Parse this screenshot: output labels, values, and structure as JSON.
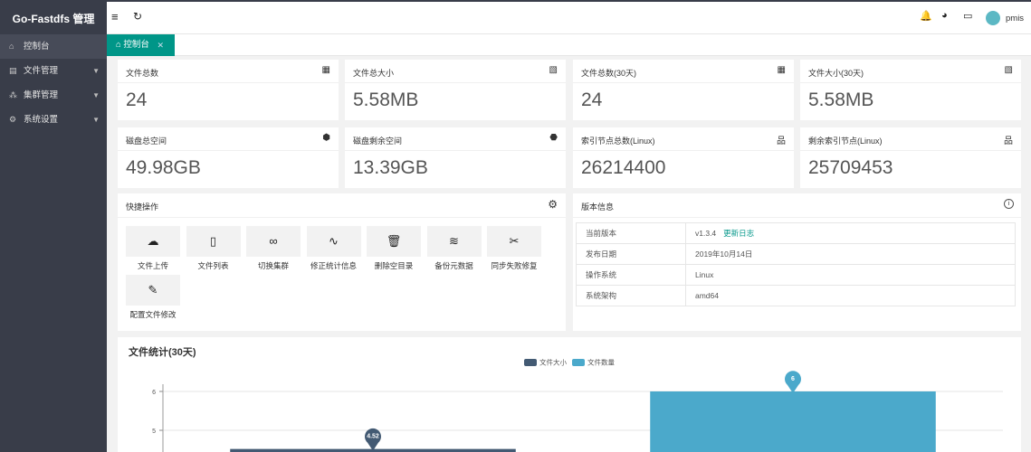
{
  "app": {
    "title": "Go-Fastdfs 管理"
  },
  "sidebar": {
    "items": [
      {
        "label": "控制台",
        "icon": "home-icon",
        "glyph": "⌂",
        "has_caret": false
      },
      {
        "label": "文件管理",
        "icon": "file-icon",
        "glyph": "▤",
        "has_caret": true
      },
      {
        "label": "集群管理",
        "icon": "cluster-icon",
        "glyph": "⁂",
        "has_caret": true
      },
      {
        "label": "系统设置",
        "icon": "gears-icon",
        "glyph": "⚙",
        "has_caret": true
      }
    ]
  },
  "header": {
    "user": "pmis"
  },
  "tabs": {
    "active": "控制台"
  },
  "stats": [
    {
      "title": "文件总数",
      "value": "24",
      "icon": "calculator-icon",
      "glyph": "▦"
    },
    {
      "title": "文件总大小",
      "value": "5.58MB",
      "icon": "file-size-icon",
      "glyph": "▧"
    },
    {
      "title": "文件总数(30天)",
      "value": "24",
      "icon": "calculator-icon",
      "glyph": "▦"
    },
    {
      "title": "文件大小(30天)",
      "value": "5.58MB",
      "icon": "file-size-icon",
      "glyph": "▧"
    },
    {
      "title": "磁盘总空间",
      "value": "49.98GB",
      "icon": "cubes-icon",
      "glyph": "⬢"
    },
    {
      "title": "磁盘剩余空间",
      "value": "13.39GB",
      "icon": "cube-icon",
      "glyph": "⬣"
    },
    {
      "title": "索引节点总数(Linux)",
      "value": "26214400",
      "icon": "sitemap-icon",
      "glyph": "品"
    },
    {
      "title": "剩余索引节点(Linux)",
      "value": "25709453",
      "icon": "sitemap-icon",
      "glyph": "品"
    }
  ],
  "quick_actions": {
    "title": "快捷操作",
    "items": [
      {
        "label": "文件上传",
        "icon": "cloud-upload-icon",
        "glyph": "☁"
      },
      {
        "label": "文件列表",
        "icon": "file-list-icon",
        "glyph": "▯"
      },
      {
        "label": "切换集群",
        "icon": "infinity-icon",
        "glyph": "∞"
      },
      {
        "label": "修正统计信息",
        "icon": "pulse-icon",
        "glyph": "∿"
      },
      {
        "label": "删除空目录",
        "icon": "trash-icon",
        "glyph": "🗑"
      },
      {
        "label": "备份元数据",
        "icon": "layers-icon",
        "glyph": "≋"
      },
      {
        "label": "同步失败修复",
        "icon": "tools-icon",
        "glyph": "✂"
      },
      {
        "label": "配置文件修改",
        "icon": "pencil-icon",
        "glyph": "✎"
      }
    ]
  },
  "version": {
    "title": "版本信息",
    "rows": [
      {
        "key": "当前版本",
        "value": "v1.3.4",
        "link": "更新日志"
      },
      {
        "key": "发布日期",
        "value": "2019年10月14日"
      },
      {
        "key": "操作系统",
        "value": "Linux"
      },
      {
        "key": "系统架构",
        "value": "amd64"
      }
    ]
  },
  "chart_data": {
    "type": "bar",
    "title": "文件统计(30天)",
    "series": [
      {
        "name": "文件大小",
        "color": "#435a73",
        "values": [
          4.52
        ]
      },
      {
        "name": "文件数量",
        "color": "#4ba9cb",
        "values": [
          6
        ]
      }
    ],
    "yticks": [
      5,
      6
    ],
    "ylim": [
      4,
      6
    ]
  }
}
